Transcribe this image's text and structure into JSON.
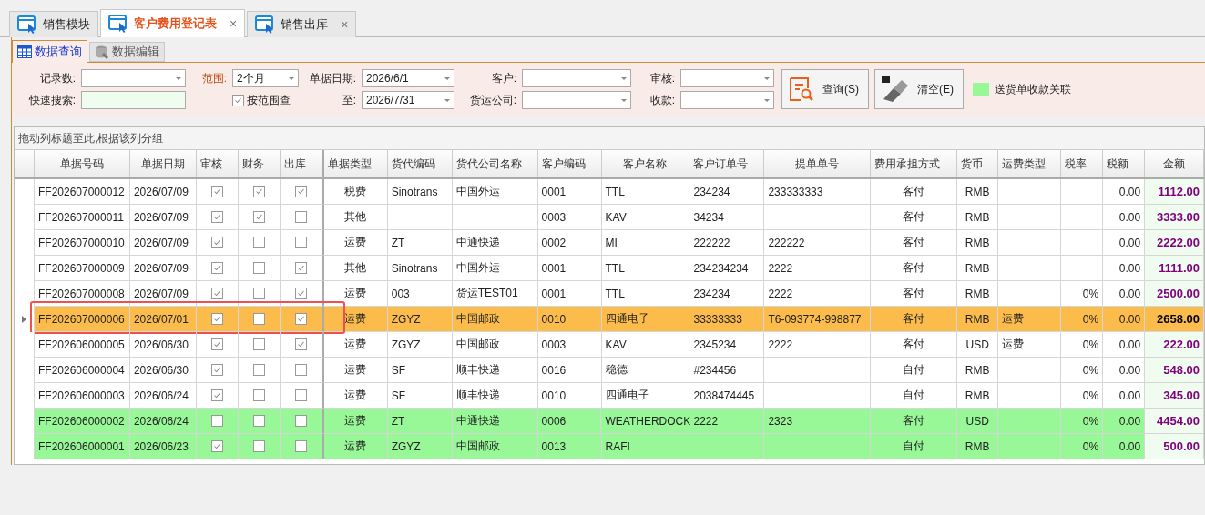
{
  "tabs": [
    {
      "label": "销售模块",
      "selected": false,
      "closable": false
    },
    {
      "label": "客户费用登记表",
      "selected": true,
      "closable": true
    },
    {
      "label": "销售出库",
      "selected": false,
      "closable": true
    }
  ],
  "close_glyph": "×",
  "sub_tabs": [
    {
      "label": "数据查询",
      "selected": true,
      "kind": "grid"
    },
    {
      "label": "数据编辑",
      "selected": false,
      "kind": "database"
    }
  ],
  "filters": [
    [
      {
        "label": "记录数:",
        "kind": "combo"
      },
      {
        "label": "快速搜索:",
        "kind": "text"
      }
    ],
    [
      {
        "label": "范围:",
        "kind": "combo",
        "value": "2个月",
        "highlighted": true
      },
      {
        "label": "按范围查",
        "kind": "check",
        "checked": true
      }
    ],
    [
      {
        "label": "单据日期:",
        "kind": "combo",
        "value": "2026/6/1"
      },
      {
        "label": "至:",
        "kind": "combo",
        "value": "2026/7/31"
      }
    ],
    [
      {
        "label": "客户:",
        "kind": "combo"
      },
      {
        "label": "货运公司:",
        "kind": "combo"
      }
    ],
    [
      {
        "label": "审核:",
        "kind": "combo"
      },
      {
        "label": "收款:",
        "kind": "combo"
      }
    ]
  ],
  "buttons": [
    {
      "label": "查询(S)",
      "kind": "search"
    },
    {
      "label": "清空(E)",
      "kind": "eraser"
    }
  ],
  "legend": {
    "label": "送货单收款关联",
    "color": "#98f898"
  },
  "group_panel": "拖动列标题至此,根据该列分组",
  "columns": [
    "单据号码",
    "单据日期",
    "审核",
    "财务",
    "出库",
    "单据类型",
    "货代编码",
    "货代公司名称",
    "客户编码",
    "客户名称",
    "客户订单号",
    "提单单号",
    "费用承担方式",
    "货币",
    "运费类型",
    "税率",
    "税额",
    "金额"
  ],
  "rows": [
    {
      "selected": false,
      "linked": false,
      "no": "FF202607000012",
      "date": "2026/07/09",
      "audited": true,
      "finance": true,
      "outbound": true,
      "type": "税费",
      "fwd_code": "Sinotrans",
      "fwd_name": "中国外运",
      "cust_code": "0001",
      "cust_name": "TTL",
      "order_no": "234234",
      "bill_no": "233333333",
      "bearer": "客付",
      "currency": "RMB",
      "tax": "0.00",
      "amount": "1112.00"
    },
    {
      "selected": false,
      "linked": false,
      "no": "FF202607000011",
      "date": "2026/07/09",
      "audited": true,
      "finance": true,
      "outbound": false,
      "type": "其他",
      "cust_code": "0003",
      "cust_name": "KAV",
      "order_no": "34234",
      "bearer": "客付",
      "currency": "RMB",
      "tax": "0.00",
      "amount": "3333.00"
    },
    {
      "selected": false,
      "linked": false,
      "no": "FF202607000010",
      "date": "2026/07/09",
      "audited": true,
      "finance": false,
      "outbound": false,
      "type": "运费",
      "fwd_code": "ZT",
      "fwd_name": "中通快递",
      "cust_code": "0002",
      "cust_name": "MI",
      "order_no": "222222",
      "bill_no": "222222",
      "bearer": "客付",
      "currency": "RMB",
      "tax": "0.00",
      "amount": "2222.00"
    },
    {
      "selected": false,
      "linked": false,
      "no": "FF202607000009",
      "date": "2026/07/09",
      "audited": true,
      "finance": false,
      "outbound": true,
      "type": "其他",
      "fwd_code": "Sinotrans",
      "fwd_name": "中国外运",
      "cust_code": "0001",
      "cust_name": "TTL",
      "order_no": "234234234",
      "bill_no": "2222",
      "bearer": "客付",
      "currency": "RMB",
      "tax": "0.00",
      "amount": "1111.00"
    },
    {
      "selected": false,
      "linked": false,
      "no": "FF202607000008",
      "date": "2026/07/09",
      "audited": true,
      "finance": false,
      "outbound": true,
      "type": "运费",
      "fwd_code": "003",
      "fwd_name": "货运TEST01",
      "cust_code": "0001",
      "cust_name": "TTL",
      "order_no": "234234",
      "bill_no": "2222",
      "bearer": "客付",
      "currency": "RMB",
      "tax_rate": "0%",
      "tax": "0.00",
      "amount": "2500.00"
    },
    {
      "selected": true,
      "linked": false,
      "no": "FF202607000006",
      "date": "2026/07/01",
      "audited": true,
      "finance": false,
      "outbound": true,
      "type": "运费",
      "fwd_code": "ZGYZ",
      "fwd_name": "中国邮政",
      "cust_code": "0010",
      "cust_name": "四通电子",
      "order_no": "33333333",
      "bill_no": "T6-093774-998877",
      "bearer": "客付",
      "currency": "RMB",
      "freight_type": "运费",
      "tax_rate": "0%",
      "tax": "0.00",
      "amount": "2658.00"
    },
    {
      "selected": false,
      "linked": false,
      "no": "FF202606000005",
      "date": "2026/06/30",
      "audited": true,
      "finance": false,
      "outbound": true,
      "type": "运费",
      "fwd_code": "ZGYZ",
      "fwd_name": "中国邮政",
      "cust_code": "0003",
      "cust_name": "KAV",
      "order_no": "2345234",
      "bill_no": "2222",
      "bearer": "客付",
      "currency": "USD",
      "freight_type": "运费",
      "tax_rate": "0%",
      "tax": "0.00",
      "amount": "222.00"
    },
    {
      "selected": false,
      "linked": false,
      "no": "FF202606000004",
      "date": "2026/06/30",
      "audited": true,
      "finance": false,
      "outbound": false,
      "type": "运费",
      "fwd_code": "SF",
      "fwd_name": "顺丰快递",
      "cust_code": "0016",
      "cust_name": "稳德",
      "order_no": "#234456",
      "bearer": "自付",
      "currency": "RMB",
      "tax_rate": "0%",
      "tax": "0.00",
      "amount": "548.00"
    },
    {
      "selected": false,
      "linked": false,
      "no": "FF202606000003",
      "date": "2026/06/24",
      "audited": true,
      "finance": false,
      "outbound": false,
      "type": "运费",
      "fwd_code": "SF",
      "fwd_name": "顺丰快递",
      "cust_code": "0010",
      "cust_name": "四通电子",
      "order_no": "2038474445",
      "bearer": "自付",
      "currency": "RMB",
      "tax_rate": "0%",
      "tax": "0.00",
      "amount": "345.00"
    },
    {
      "selected": false,
      "linked": true,
      "no": "FF202606000002",
      "date": "2026/06/24",
      "audited": false,
      "finance": false,
      "outbound": false,
      "type": "运费",
      "fwd_code": "ZT",
      "fwd_name": "中通快递",
      "cust_code": "0006",
      "cust_name": "WEATHERDOCK",
      "order_no": "2222",
      "bill_no": "2323",
      "bearer": "客付",
      "currency": "USD",
      "tax_rate": "0%",
      "tax": "0.00",
      "amount": "4454.00"
    },
    {
      "selected": false,
      "linked": true,
      "no": "FF202606000001",
      "date": "2026/06/23",
      "audited": true,
      "finance": false,
      "outbound": false,
      "type": "运费",
      "fwd_code": "ZGYZ",
      "fwd_name": "中国邮政",
      "cust_code": "0013",
      "cust_name": "RAFI",
      "bearer": "自付",
      "currency": "RMB",
      "tax_rate": "0%",
      "tax": "0.00",
      "amount": "500.00"
    }
  ]
}
